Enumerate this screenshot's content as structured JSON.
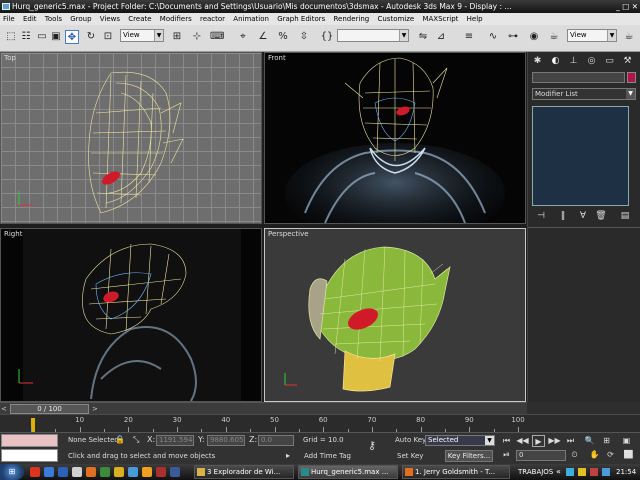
{
  "window": {
    "title": "Hurq_generic5.max   - Project Folder: C:\\Documents and Settings\\Usuario\\Mis documentos\\3dsmax   - Autodesk 3ds Max 9   - Display : ..."
  },
  "menu": [
    "File",
    "Edit",
    "Tools",
    "Group",
    "Views",
    "Create",
    "Modifiers",
    "reactor",
    "Animation",
    "Graph Editors",
    "Rendering",
    "Customize",
    "MAXScript",
    "Help"
  ],
  "toolbar": {
    "ref_coord_value": "View",
    "named_selection_value": "",
    "right_combo_value": "View"
  },
  "viewports": {
    "top": "Top",
    "front": "Front",
    "right": "Right",
    "perspective": "Perspective"
  },
  "command_panel": {
    "modifier_list": "Modifier List",
    "object_color": "#b0154a"
  },
  "time_slider": {
    "frame_label": "0 / 100",
    "prev": "<",
    "next": ">",
    "progress": 0
  },
  "track_bar": {
    "ticks": [
      "10",
      "20",
      "30",
      "40",
      "50",
      "60",
      "70",
      "80",
      "90",
      "100"
    ]
  },
  "status": {
    "selection": "None Selected",
    "prompt": "Click and drag to select and move objects",
    "x_label": "X:",
    "x_value": "1191.594",
    "y_label": "Y:",
    "y_value": "9880.605",
    "z_label": "Z:",
    "z_value": "0.0",
    "grid": "Grid = 10.0",
    "add_time_tag": "Add Time Tag",
    "auto_key": "Auto Key",
    "selected_value": "Selected",
    "set_key": "Set Key",
    "key_filters": "Key Filters...",
    "current_frame": "0"
  },
  "taskbar": {
    "start": "⊞",
    "tasks": [
      "3 Explorador de Wi...",
      "Hurq_generic5.max ...",
      "1. Jerry Goldsmith - T..."
    ],
    "tray_label": "TRABAJOS",
    "clock": "21:54"
  },
  "colors": {
    "wireframe": "#f0e8a0",
    "model_green": "#8ab83a",
    "eye_red": "#d01a2a",
    "neck_yellow": "#e0c040"
  }
}
